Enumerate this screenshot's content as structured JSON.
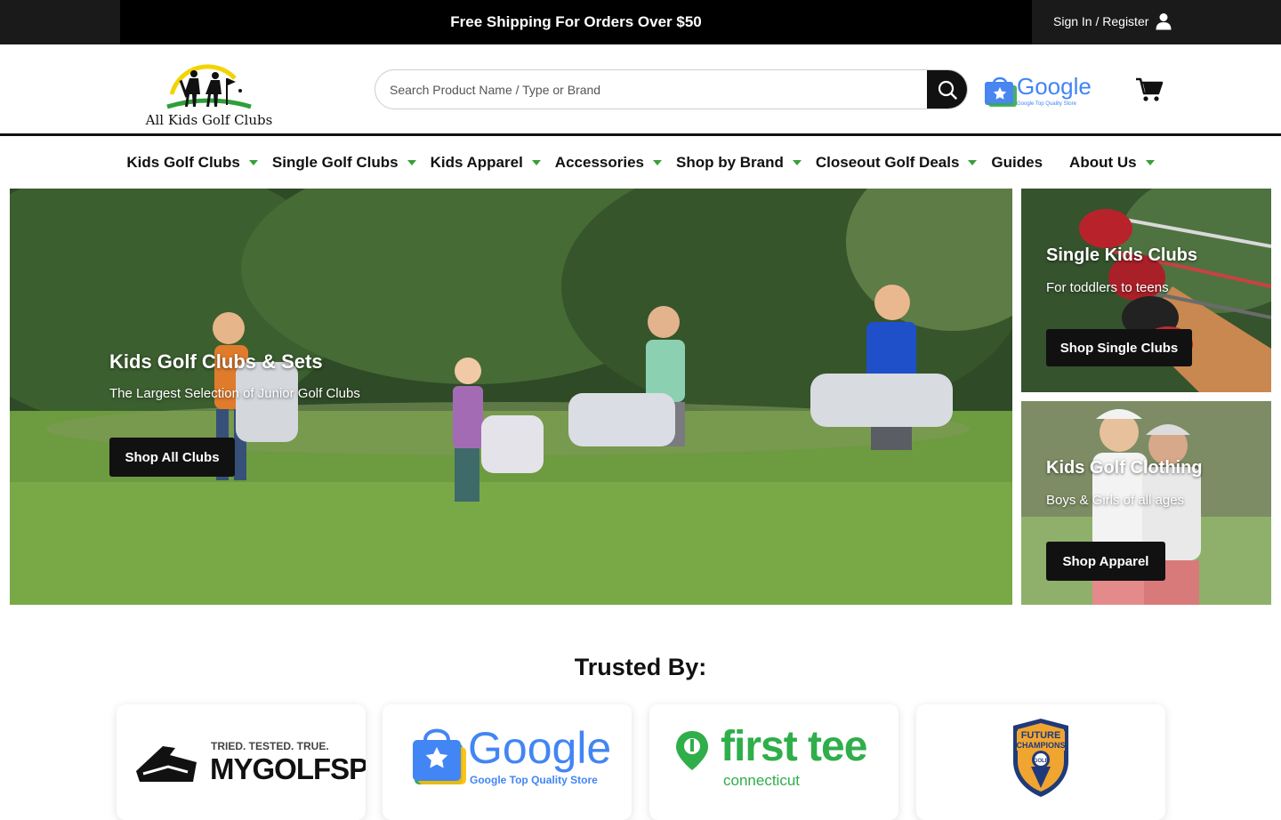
{
  "topbar": {
    "promo": "Free Shipping For Orders Over $50",
    "signin_label": "Sign In / Register",
    "signin_icon": "user-icon"
  },
  "header": {
    "logo_text": "All Kids Golf Clubs",
    "search_placeholder": "Search Product Name / Type or Brand",
    "search_icon": "search-icon",
    "badge_word": "Google",
    "badge_sub": "Google Top Quality Store",
    "cart_icon": "cart-icon"
  },
  "nav": {
    "items": [
      {
        "label": "Kids Golf Clubs",
        "dropdown": true
      },
      {
        "label": "Single Golf Clubs",
        "dropdown": true
      },
      {
        "label": "Kids Apparel",
        "dropdown": true
      },
      {
        "label": "Accessories",
        "dropdown": true
      },
      {
        "label": "Shop by Brand",
        "dropdown": true
      },
      {
        "label": "Closeout Golf Deals",
        "dropdown": true
      },
      {
        "label": "Guides",
        "dropdown": false
      },
      {
        "label": "About Us",
        "dropdown": true
      }
    ],
    "caret_color": "#3a9e3a"
  },
  "hero": {
    "main": {
      "title": "Kids Golf Clubs & Sets",
      "subtitle": "The Largest Selection of Junior Golf Clubs",
      "button": "Shop All Clubs"
    },
    "side1": {
      "title": "Single Kids Clubs",
      "subtitle": "For toddlers to teens",
      "button": "Shop Single Clubs"
    },
    "side2": {
      "title": "Kids Golf Clothing",
      "subtitle": "Boys & Girls of all ages",
      "button": "Shop Apparel"
    }
  },
  "trusted": {
    "title": "Trusted By:",
    "logos": [
      {
        "tagline": "TRIED. TESTED. TRUE.",
        "name": "MYGOLFSPY"
      },
      {
        "name": "Google",
        "sub": "Google Top Quality Store"
      },
      {
        "name": "first tee",
        "sub": "connecticut"
      },
      {
        "name": "FUTURE CHAMPIONS",
        "sub": "GOLF"
      }
    ]
  }
}
